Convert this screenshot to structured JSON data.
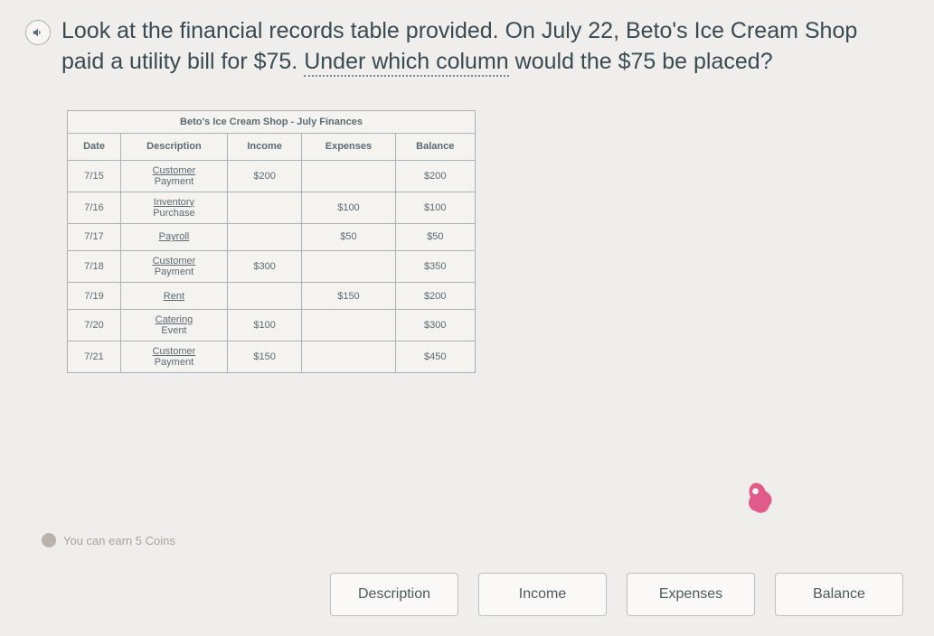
{
  "question": {
    "part1": "Look at the financial records table provided. On July 22, Beto's Ice Cream Shop paid a utility bill for $75. ",
    "underlined": "Under which column",
    "part2": " would the $75 be placed?"
  },
  "table": {
    "title": "Beto's Ice Cream Shop - July Finances",
    "headers": [
      "Date",
      "Description",
      "Income",
      "Expenses",
      "Balance"
    ],
    "rows": [
      {
        "date": "7/15",
        "desc1": "Customer",
        "desc2": "Payment",
        "income": "$200",
        "expenses": "",
        "balance": "$200"
      },
      {
        "date": "7/16",
        "desc1": "Inventory",
        "desc2": "Purchase",
        "income": "",
        "expenses": "$100",
        "balance": "$100"
      },
      {
        "date": "7/17",
        "desc1": "Payroll",
        "desc2": "",
        "income": "",
        "expenses": "$50",
        "balance": "$50"
      },
      {
        "date": "7/18",
        "desc1": "Customer",
        "desc2": "Payment",
        "income": "$300",
        "expenses": "",
        "balance": "$350"
      },
      {
        "date": "7/19",
        "desc1": "Rent",
        "desc2": "",
        "income": "",
        "expenses": "$150",
        "balance": "$200"
      },
      {
        "date": "7/20",
        "desc1": "Catering",
        "desc2": "Event",
        "income": "$100",
        "expenses": "",
        "balance": "$300"
      },
      {
        "date": "7/21",
        "desc1": "Customer",
        "desc2": "Payment",
        "income": "$150",
        "expenses": "",
        "balance": "$450"
      }
    ]
  },
  "earn_text": "You can earn 5 Coins",
  "answers": [
    "Description",
    "Income",
    "Expenses",
    "Balance"
  ]
}
